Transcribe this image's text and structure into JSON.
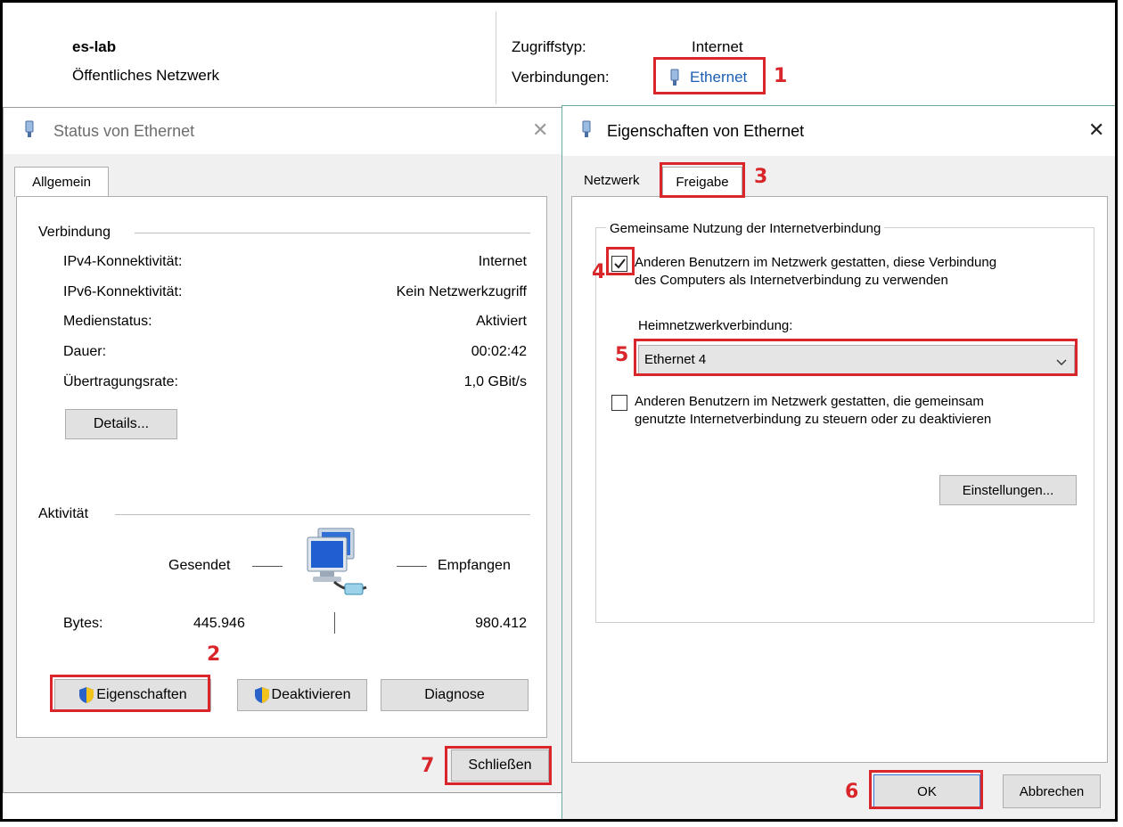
{
  "network": {
    "name": "es-lab",
    "type": "Öffentliches Netzwerk",
    "access_label": "Zugriffstyp:",
    "access_value": "Internet",
    "connections_label": "Verbindungen:",
    "connection_link": "Ethernet"
  },
  "status_dialog": {
    "title": "Status von Ethernet",
    "tab": "Allgemein",
    "connection_group": "Verbindung",
    "rows": [
      {
        "label": "IPv4-Konnektivität:",
        "value": "Internet"
      },
      {
        "label": "IPv6-Konnektivität:",
        "value": "Kein Netzwerkzugriff"
      },
      {
        "label": "Medienstatus:",
        "value": "Aktiviert"
      },
      {
        "label": "Dauer:",
        "value": "00:02:42"
      },
      {
        "label": "Übertragungsrate:",
        "value": "1,0 GBit/s"
      }
    ],
    "details_button": "Details...",
    "activity_group": "Aktivität",
    "sent_label": "Gesendet",
    "received_label": "Empfangen",
    "bytes_label": "Bytes:",
    "bytes_sent": "445.946",
    "bytes_received": "980.412",
    "properties_button": "Eigenschaften",
    "disable_button": "Deaktivieren",
    "diagnose_button": "Diagnose",
    "close_button": "Schließen"
  },
  "properties_dialog": {
    "title": "Eigenschaften von Ethernet",
    "tab_network": "Netzwerk",
    "tab_sharing": "Freigabe",
    "group_title": "Gemeinsame Nutzung der Internetverbindung",
    "allow_share_line1": "Anderen Benutzern im Netzwerk gestatten, diese Verbindung",
    "allow_share_line2": "des Computers als Internetverbindung zu verwenden",
    "allow_share_checked": true,
    "home_network_label": "Heimnetzwerkverbindung:",
    "home_network_value": "Ethernet 4",
    "allow_control_line1": "Anderen Benutzern im Netzwerk gestatten, die gemeinsam",
    "allow_control_line2": "genutzte Internetverbindung zu steuern oder zu deaktivieren",
    "allow_control_checked": false,
    "settings_button": "Einstellungen...",
    "ok_button": "OK",
    "cancel_button": "Abbrechen"
  },
  "annotations": [
    "1",
    "2",
    "3",
    "4",
    "5",
    "6",
    "7"
  ],
  "colors": {
    "annotation": "#d9262b",
    "link": "#1a5fb4",
    "shield_blue": "#2a62c9",
    "shield_yellow": "#f3c21b"
  }
}
